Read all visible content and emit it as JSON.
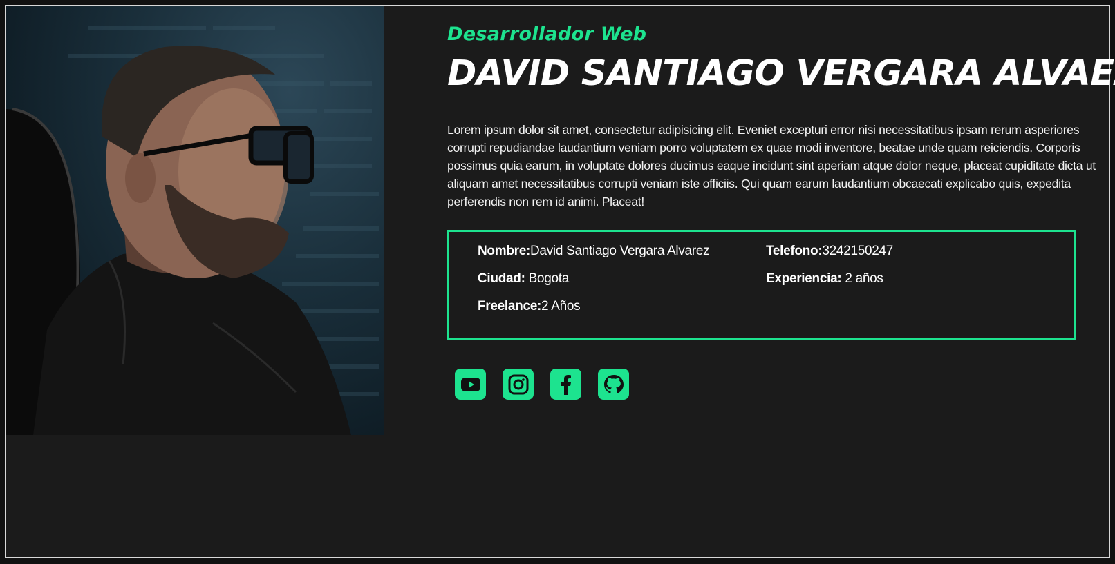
{
  "hero": {
    "role": "Desarrollador Web",
    "name": "DAVID SANTIAGO VERGARA ALVAEZ",
    "bio": "Lorem ipsum dolor sit amet, consectetur adipisicing elit. Eveniet excepturi error nisi necessitatibus ipsam rerum asperiores corrupti repudiandae laudantium veniam porro voluptatem ex quae modi inventore, beatae unde quam reiciendis. Corporis possimus quia earum, in voluptate dolores ducimus eaque incidunt sint aperiam atque dolor neque, placeat cupiditate dicta ut aliquam amet necessitatibus corrupti veniam iste officiis. Qui quam earum laudantium obcaecati explicabo quis, expedita perferendis non rem id animi. Placeat!"
  },
  "info": {
    "nombre_label": "Nombre:",
    "nombre_value": "David Santiago Vergara Alvarez",
    "telefono_label": "Telefono:",
    "telefono_value": "3242150247",
    "ciudad_label": "Ciudad:",
    "ciudad_value": " Bogota",
    "experiencia_label": "Experiencia:",
    "experiencia_value": " 2 años",
    "freelance_label": "Freelance:",
    "freelance_value": "2 Años"
  },
  "socials": [
    {
      "icon": "youtube-icon"
    },
    {
      "icon": "instagram-icon"
    },
    {
      "icon": "facebook-icon"
    },
    {
      "icon": "github-icon"
    }
  ],
  "colors": {
    "accent": "#1de38f",
    "background": "#1b1b1b",
    "text": "#ffffff"
  }
}
